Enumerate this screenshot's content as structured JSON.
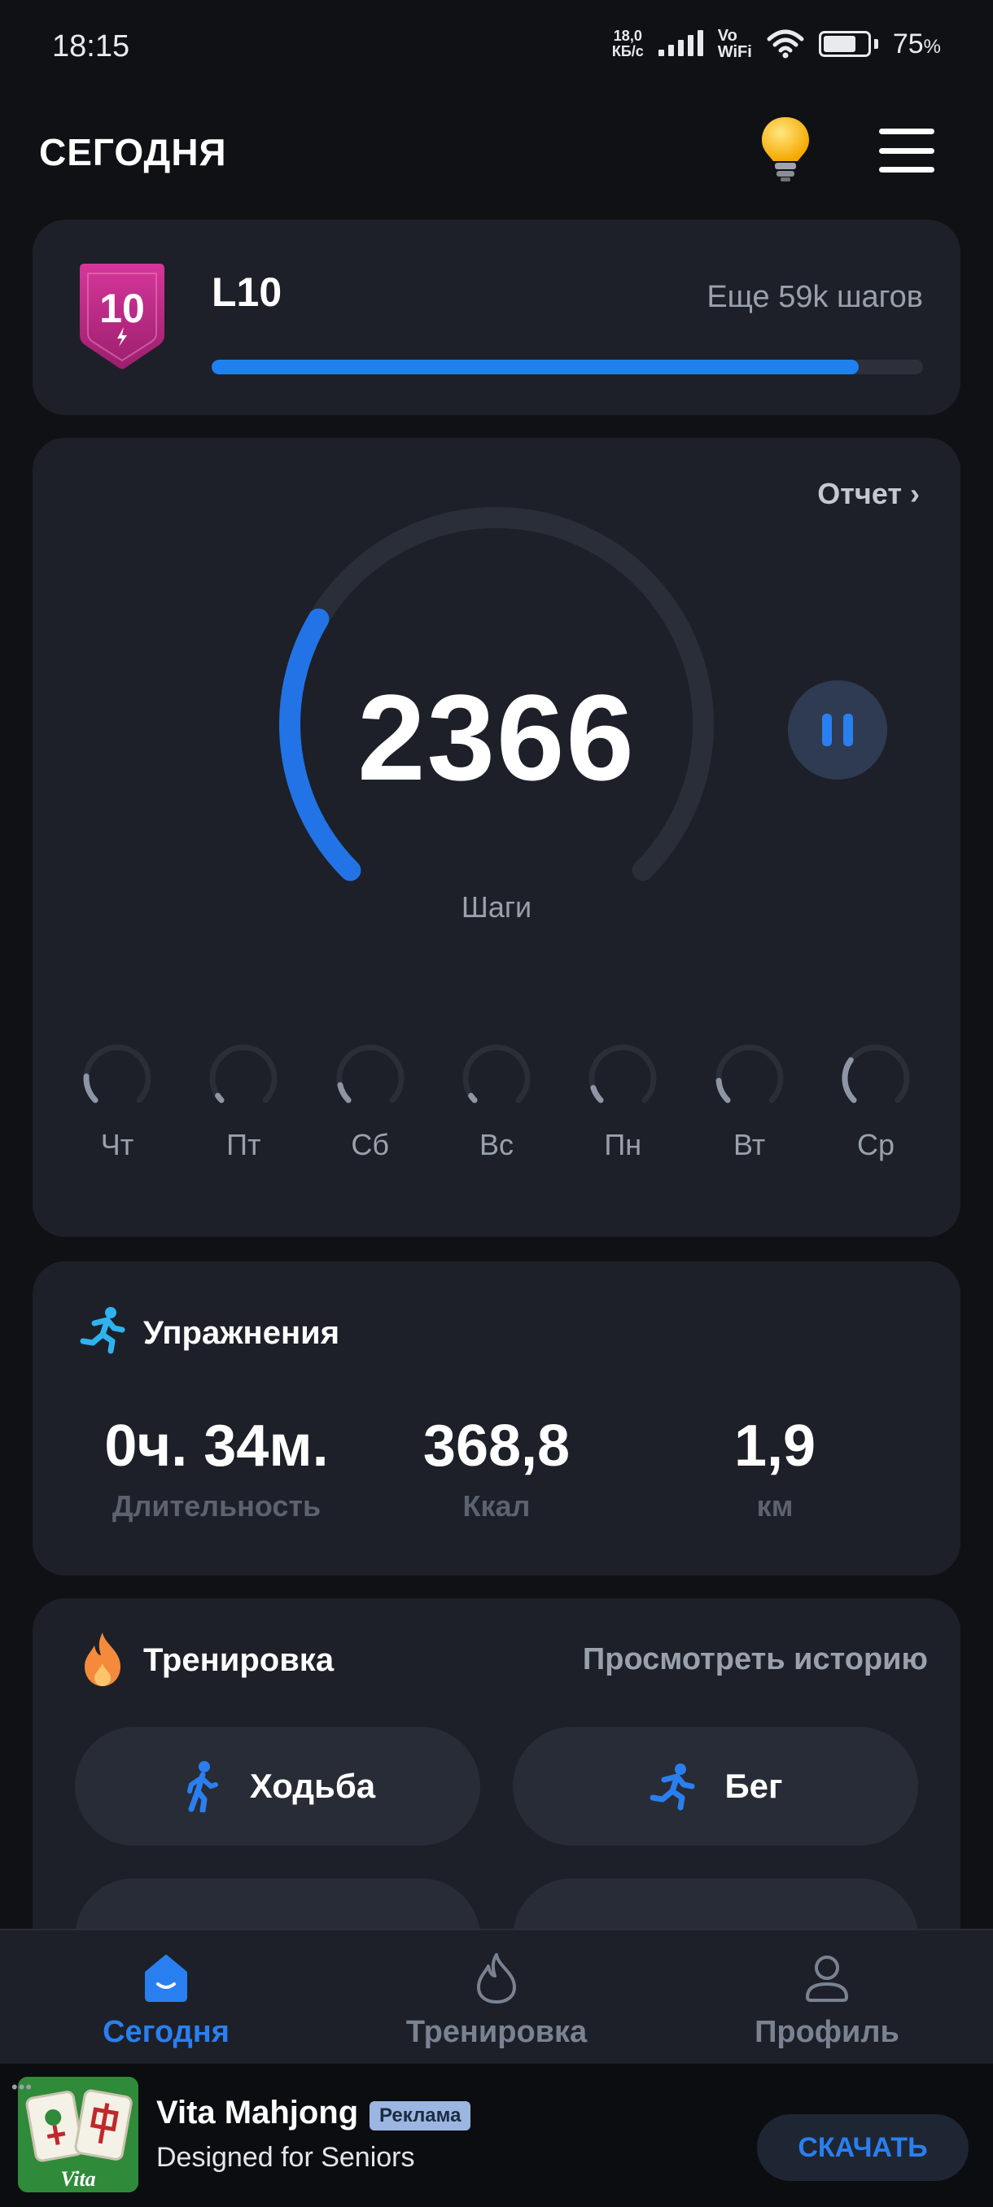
{
  "status_bar": {
    "time": "18:15",
    "net_speed_value": "18,0",
    "net_speed_unit": "КБ/с",
    "vowifi_top": "Vo",
    "vowifi_bottom": "WiFi",
    "battery": "75",
    "battery_unit": "%"
  },
  "header": {
    "title": "СЕГОДНЯ",
    "bulb_icon": "lightbulb-icon",
    "menu_icon": "hamburger-menu-icon"
  },
  "level": {
    "badge_number": "10",
    "name": "L10",
    "remaining": "Еще 59k шагов",
    "progress": 0.91
  },
  "steps": {
    "report_label": "Отчет",
    "value": "2366",
    "label": "Шаги",
    "progress": 0.28,
    "days": [
      {
        "label": "Чт",
        "progress": 0.18
      },
      {
        "label": "Пт",
        "progress": 0.04
      },
      {
        "label": "Сб",
        "progress": 0.12
      },
      {
        "label": "Вс",
        "progress": 0.04
      },
      {
        "label": "Пн",
        "progress": 0.1
      },
      {
        "label": "Вт",
        "progress": 0.15
      },
      {
        "label": "Ср",
        "progress": 0.3
      }
    ]
  },
  "exercise": {
    "title": "Упражнения",
    "duration_value": "0ч. 34м.",
    "duration_label": "Длительность",
    "kcal_value": "368,8",
    "kcal_label": "Ккал",
    "distance_value": "1,9",
    "distance_label": "км"
  },
  "workout": {
    "title": "Тренировка",
    "history_label": "Просмотреть историю",
    "walk_label": "Ходьба",
    "run_label": "Бег"
  },
  "nav": {
    "today": "Сегодня",
    "workout": "Тренировка",
    "profile": "Профиль"
  },
  "ad": {
    "title": "Vita Mahjong",
    "tag": "Реклама",
    "subtitle": "Designed for Seniors",
    "button": "СКАЧАТЬ",
    "image_logo": "Vita"
  },
  "colors": {
    "accent": "#1f80f0",
    "card": "#1d2028",
    "background": "#0f1115",
    "badge": "#b8297f"
  }
}
